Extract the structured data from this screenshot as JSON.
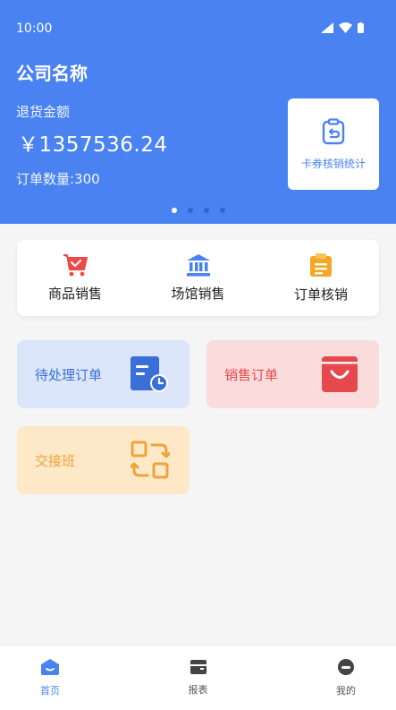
{
  "status_bar": {
    "time": "10:00"
  },
  "header": {
    "company": "公司名称",
    "refund_label": "退货金额",
    "refund_amount": "￥1357536.24",
    "order_count": "订单数量:300",
    "card_stat_label": "卡券核销统计"
  },
  "carousel": {
    "pages": 4,
    "active": 1
  },
  "quick_actions": [
    {
      "label": "商品销售",
      "icon": "cart-icon"
    },
    {
      "label": "场馆销售",
      "icon": "venue-icon"
    },
    {
      "label": "订单核销",
      "icon": "clipboard-icon"
    }
  ],
  "tiles": {
    "pending": "待处理订单",
    "sales": "销售订单",
    "shift": "交接班"
  },
  "tabbar": [
    {
      "label": "首页",
      "icon": "home-icon",
      "active": true
    },
    {
      "label": "报表",
      "icon": "report-icon",
      "active": false
    },
    {
      "label": "我的",
      "icon": "profile-icon",
      "active": false
    }
  ],
  "colors": {
    "primary": "#4a83f1",
    "red": "#e5484d",
    "orange": "#f0a33a"
  }
}
